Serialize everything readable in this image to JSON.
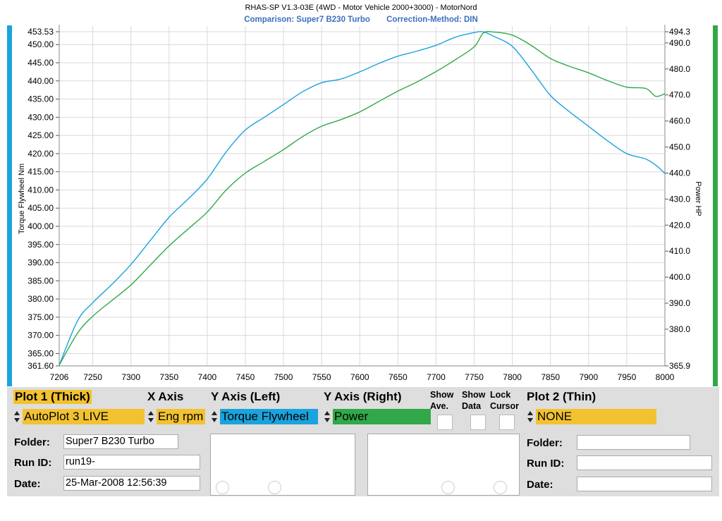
{
  "header": {
    "title": "RHAS-SP V1.3-03E  (4WD - Motor Vehicle 2000+3000) - MotorNord",
    "comparison": "Comparison: Super7 B230 Turbo",
    "correction": "Correction-Method: DIN"
  },
  "colors": {
    "blue": "#1aa3dc",
    "green": "#31a84a",
    "yellow": "#f2c230"
  },
  "chart_data": {
    "type": "line",
    "xlabel": "",
    "ylabel_left": "Torque Flywheel Nm",
    "ylabel_right": "Power HP",
    "xlim": [
      7206,
      8000
    ],
    "ylim_left": [
      361.6,
      453.53
    ],
    "ylim_right": [
      365.9,
      494.3
    ],
    "x_ticks": [
      7206,
      7250,
      7300,
      7350,
      7400,
      7450,
      7500,
      7550,
      7600,
      7650,
      7700,
      7750,
      7800,
      7850,
      7900,
      7950,
      8000
    ],
    "y_left_ticks": [
      361.6,
      365.0,
      370.0,
      375.0,
      380.0,
      385.0,
      390.0,
      395.0,
      400.0,
      405.0,
      410.0,
      415.0,
      420.0,
      425.0,
      430.0,
      435.0,
      440.0,
      445.0,
      450.0,
      453.53
    ],
    "y_left_tick_labels": [
      "361.60",
      "365.00",
      "370.00",
      "375.00",
      "380.00",
      "385.00",
      "390.00",
      "395.00",
      "400.00",
      "405.00",
      "410.00",
      "415.00",
      "420.00",
      "425.00",
      "430.00",
      "435.00",
      "440.00",
      "445.00",
      "450.00",
      "453.53"
    ],
    "y_right_ticks": [
      365.9,
      380.0,
      390.0,
      400.0,
      410.0,
      420.0,
      430.0,
      440.0,
      450.0,
      460.0,
      470.0,
      480.0,
      490.0,
      494.3
    ],
    "y_right_tick_labels": [
      "365.9",
      "380.0",
      "390.0",
      "400.0",
      "410.0",
      "420.0",
      "430.0",
      "440.0",
      "450.0",
      "460.0",
      "470.0",
      "480.0",
      "490.0",
      "494.3"
    ],
    "grid": true,
    "series": [
      {
        "axis": "left",
        "color": "#1aa3dc",
        "x": [
          7206,
          7230,
          7250,
          7275,
          7300,
          7325,
          7350,
          7375,
          7400,
          7425,
          7450,
          7475,
          7500,
          7525,
          7550,
          7575,
          7600,
          7625,
          7650,
          7675,
          7700,
          7725,
          7750,
          7762,
          7775,
          7800,
          7825,
          7850,
          7875,
          7900,
          7925,
          7950,
          7975,
          7990,
          8000
        ],
        "y": [
          361.8,
          374.0,
          379.0,
          384.0,
          389.5,
          396.0,
          402.5,
          407.5,
          413.0,
          420.5,
          426.5,
          430.0,
          433.5,
          437.0,
          439.5,
          440.5,
          442.5,
          444.8,
          446.8,
          448.2,
          449.8,
          452.0,
          453.3,
          453.5,
          452.3,
          449.5,
          443.0,
          436.0,
          431.5,
          427.5,
          423.5,
          420.0,
          418.5,
          416.5,
          414.5
        ]
      },
      {
        "axis": "right",
        "color": "#31a84a",
        "x": [
          7206,
          7230,
          7250,
          7275,
          7300,
          7325,
          7350,
          7375,
          7400,
          7425,
          7450,
          7475,
          7500,
          7525,
          7550,
          7575,
          7600,
          7625,
          7650,
          7675,
          7700,
          7725,
          7750,
          7762,
          7775,
          7800,
          7825,
          7850,
          7875,
          7900,
          7925,
          7950,
          7975,
          7988,
          8000
        ],
        "y": [
          366.2,
          378.5,
          385.0,
          391.0,
          397.0,
          404.5,
          412.0,
          418.5,
          425.0,
          433.5,
          440.0,
          444.5,
          449.0,
          454.0,
          458.0,
          460.5,
          463.5,
          467.5,
          471.5,
          475.0,
          479.0,
          483.5,
          488.5,
          493.8,
          494.2,
          493.0,
          489.0,
          484.0,
          481.0,
          478.5,
          475.5,
          473.0,
          472.5,
          469.5,
          470.5
        ]
      }
    ]
  },
  "panel": {
    "plot1_label": "Plot 1 (Thick)",
    "x_axis_label": "X Axis",
    "y_left_label": "Y Axis (Left)",
    "y_right_label": "Y Axis (Right)",
    "show_ave_1": "Show",
    "show_ave_2": "Ave.",
    "show_data_1": "Show",
    "show_data_2": "Data",
    "lock_cursor_1": "Lock",
    "lock_cursor_2": "Cursor",
    "plot2_label": "Plot 2 (Thin)",
    "plot1_value": "AutoPlot 3 LIVE",
    "x_axis_value": "Eng rpm",
    "y_left_value": "Torque Flywheel",
    "y_right_value": "Power",
    "plot2_value": "NONE",
    "folder_label": "Folder:",
    "run_id_label": "Run ID:",
    "date_label": "Date:",
    "folder_value": "Super7 B230 Turbo",
    "run_id_value": "run19-",
    "date_value": "25-Mar-2008  12:56:39",
    "folder2_label": "Folder:",
    "run_id2_label": "Run ID:",
    "date2_label": "Date:",
    "folder2_value": "",
    "run_id2_value": "",
    "date2_value": ""
  }
}
